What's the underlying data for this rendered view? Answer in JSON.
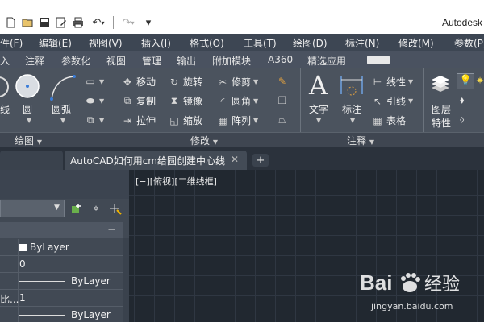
{
  "app": {
    "title": "Autodesk"
  },
  "quick_access": [
    {
      "name": "new-icon",
      "glyph": "🗋"
    },
    {
      "name": "open-icon",
      "glyph": "📂"
    },
    {
      "name": "save-icon",
      "glyph": "💾"
    },
    {
      "name": "save-as-icon",
      "glyph": "📝"
    },
    {
      "name": "print-icon",
      "glyph": "🖶"
    },
    {
      "name": "undo-icon",
      "glyph": "↶"
    },
    {
      "name": "redo-icon",
      "glyph": "↷"
    },
    {
      "name": "customize-icon",
      "glyph": "▾"
    }
  ],
  "menu": [
    "件(F)",
    "编辑(E)",
    "视图(V)",
    "插入(I)",
    "格式(O)",
    "工具(T)",
    "绘图(D)",
    "标注(N)",
    "修改(M)",
    "参数(P)"
  ],
  "ribbon_tabs": [
    "入",
    "注释",
    "参数化",
    "视图",
    "管理",
    "输出",
    "附加模块",
    "A360",
    "精选应用"
  ],
  "ribbon": {
    "draw": {
      "line": "线",
      "circle": "圆",
      "arc": "圆弧",
      "title": "绘图"
    },
    "modify": {
      "move": "移动",
      "rotate": "旋转",
      "trim": "修剪",
      "copy": "复制",
      "mirror": "镜像",
      "fillet": "圆角",
      "stretch": "拉伸",
      "scale": "缩放",
      "array": "阵列",
      "title": "修改"
    },
    "annotation": {
      "text": "文字",
      "dimension": "标注",
      "linear": "线性",
      "leader": "引线",
      "table": "表格",
      "title": "注释"
    },
    "layers": {
      "properties": "图层",
      "properties2": "特性"
    }
  },
  "doc_tabs": {
    "active": "AutoCAD如何用cm给圆创建中心线",
    "close": "✕",
    "add": "+"
  },
  "viewport": {
    "label": "[−][俯视][二维线框]"
  },
  "properties": {
    "section_toggle": "−",
    "rows": [
      {
        "label": "",
        "value": "ByLayer",
        "swatch": "square"
      },
      {
        "label": "",
        "value": "0",
        "swatch": ""
      },
      {
        "label": "",
        "value": "ByLayer",
        "swatch": "line"
      },
      {
        "label": "比...",
        "value": "1",
        "swatch": ""
      },
      {
        "label": "",
        "value": "ByLayer",
        "swatch": "line"
      }
    ]
  },
  "watermark": {
    "brand": "Bai🐾经验",
    "url": "jingyan.baidu.com"
  },
  "colors": {
    "menubar": "#3d4653",
    "ribbon": "#4b535e",
    "canvas": "#212830",
    "grid": "#2f3742"
  }
}
